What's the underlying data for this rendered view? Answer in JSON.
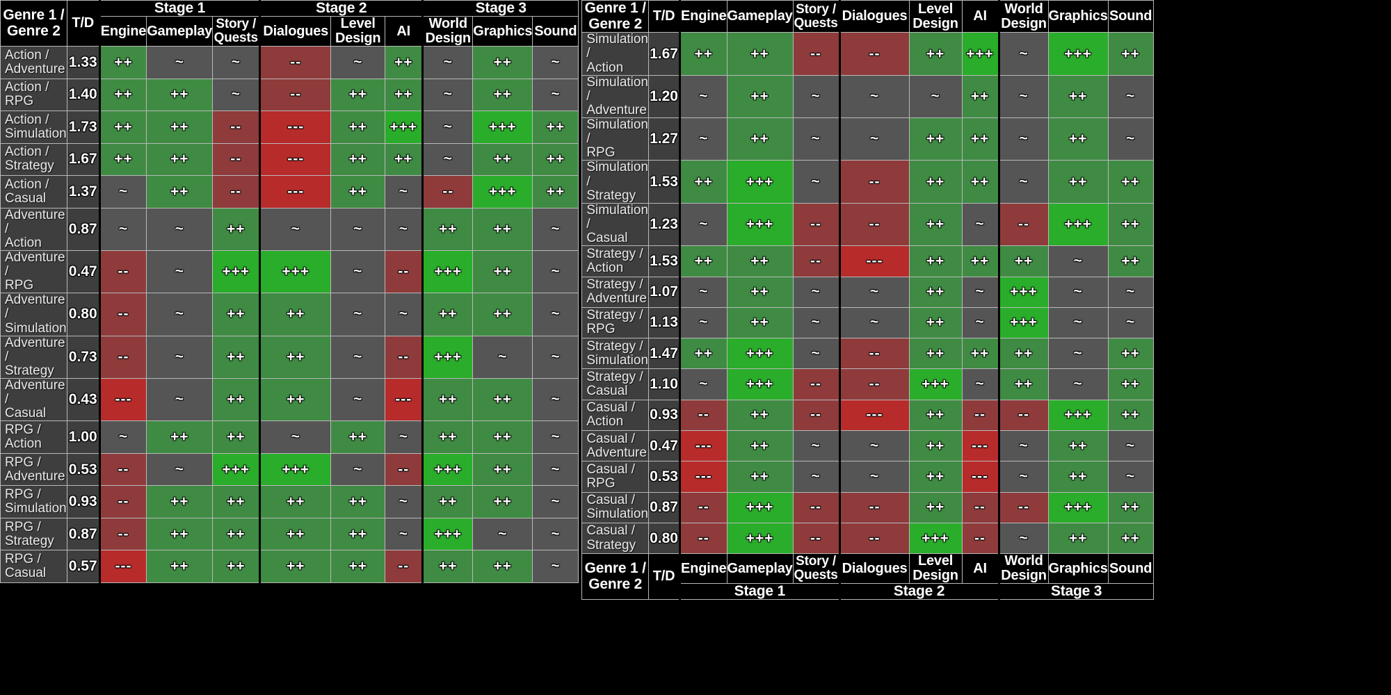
{
  "headers": {
    "genre_label": "Genre 1 /\nGenre 2",
    "genre_line1": "Genre 1 /",
    "genre_line2": "Genre 2",
    "td_label": "T/D",
    "stage1": "Stage 1",
    "stage2": "Stage 2",
    "stage3": "Stage 3",
    "columns": [
      {
        "key": "engine",
        "label": "Engine",
        "line1": "Engine",
        "line2": "",
        "stage": "Stage 1"
      },
      {
        "key": "gameplay",
        "label": "Gameplay",
        "line1": "Gameplay",
        "line2": "",
        "stage": "Stage 1"
      },
      {
        "key": "story_quests",
        "label": "Story / Quests",
        "line1": "Story /",
        "line2": "Quests",
        "stage": "Stage 1"
      },
      {
        "key": "dialogues",
        "label": "Dialogues",
        "line1": "Dialogues",
        "line2": "",
        "stage": "Stage 2"
      },
      {
        "key": "level_design",
        "label": "Level Design",
        "line1": "Level",
        "line2": "Design",
        "stage": "Stage 2"
      },
      {
        "key": "ai",
        "label": "AI",
        "line1": "AI",
        "line2": "",
        "stage": "Stage 2"
      },
      {
        "key": "world_design",
        "label": "World Design",
        "line1": "World",
        "line2": "Design",
        "stage": "Stage 3"
      },
      {
        "key": "graphics",
        "label": "Graphics",
        "line1": "Graphics",
        "line2": "",
        "stage": "Stage 3"
      },
      {
        "key": "sound",
        "label": "Sound",
        "line1": "Sound",
        "line2": "",
        "stage": "Stage 3"
      }
    ]
  },
  "rating_legend": {
    "very_positive": "+++",
    "positive": "++",
    "neutral": "~",
    "negative": "--",
    "very_negative": "---"
  },
  "colors": {
    "very_positive": "#2aad2a",
    "positive": "#3f8b43",
    "neutral": "#555555",
    "negative": "#8f3b3b",
    "very_negative": "#b82b2b",
    "header_bg": "#000000",
    "label_bg": "#3e3e3e",
    "grid_line": "#b9b9b9"
  },
  "left_table": {
    "rows": [
      {
        "genre1": "Action",
        "genre2": "Adventure",
        "label_l1": "Action /",
        "label_l2": "Adventure",
        "td": "1.33",
        "ratings": [
          "++",
          "~",
          "~",
          "--",
          "~",
          "++",
          "~",
          "++",
          "~"
        ]
      },
      {
        "genre1": "Action",
        "genre2": "RPG",
        "label_l1": "Action /",
        "label_l2": "RPG",
        "td": "1.40",
        "ratings": [
          "++",
          "++",
          "~",
          "--",
          "++",
          "++",
          "~",
          "++",
          "~"
        ]
      },
      {
        "genre1": "Action",
        "genre2": "Simulation",
        "label_l1": "Action /",
        "label_l2": "Simulation",
        "td": "1.73",
        "ratings": [
          "++",
          "++",
          "--",
          "---",
          "++",
          "+++",
          "~",
          "+++",
          "++"
        ]
      },
      {
        "genre1": "Action",
        "genre2": "Strategy",
        "label_l1": "Action /",
        "label_l2": "Strategy",
        "td": "1.67",
        "ratings": [
          "++",
          "++",
          "--",
          "---",
          "++",
          "++",
          "~",
          "++",
          "++"
        ]
      },
      {
        "genre1": "Action",
        "genre2": "Casual",
        "label_l1": "Action /",
        "label_l2": "Casual",
        "td": "1.37",
        "ratings": [
          "~",
          "++",
          "--",
          "---",
          "++",
          "~",
          "--",
          "+++",
          "++"
        ]
      },
      {
        "genre1": "Adventure",
        "genre2": "Action",
        "label_l1": "Adventure /",
        "label_l2": "Action",
        "td": "0.87",
        "ratings": [
          "~",
          "~",
          "++",
          "~",
          "~",
          "~",
          "++",
          "++",
          "~"
        ]
      },
      {
        "genre1": "Adventure",
        "genre2": "RPG",
        "label_l1": "Adventure /",
        "label_l2": "RPG",
        "td": "0.47",
        "ratings": [
          "--",
          "~",
          "+++",
          "+++",
          "~",
          "--",
          "+++",
          "++",
          "~"
        ]
      },
      {
        "genre1": "Adventure",
        "genre2": "Simulation",
        "label_l1": "Adventure /",
        "label_l2": "Simulation",
        "td": "0.80",
        "ratings": [
          "--",
          "~",
          "++",
          "++",
          "~",
          "~",
          "++",
          "++",
          "~"
        ]
      },
      {
        "genre1": "Adventure",
        "genre2": "Strategy",
        "label_l1": "Adventure /",
        "label_l2": "Strategy",
        "td": "0.73",
        "ratings": [
          "--",
          "~",
          "++",
          "++",
          "~",
          "--",
          "+++",
          "~",
          "~"
        ]
      },
      {
        "genre1": "Adventure",
        "genre2": "Casual",
        "label_l1": "Adventure /",
        "label_l2": "Casual",
        "td": "0.43",
        "ratings": [
          "---",
          "~",
          "++",
          "++",
          "~",
          "---",
          "++",
          "++",
          "~"
        ]
      },
      {
        "genre1": "RPG",
        "genre2": "Action",
        "label_l1": "RPG /",
        "label_l2": "Action",
        "td": "1.00",
        "ratings": [
          "~",
          "++",
          "++",
          "~",
          "++",
          "~",
          "++",
          "++",
          "~"
        ]
      },
      {
        "genre1": "RPG",
        "genre2": "Adventure",
        "label_l1": "RPG /",
        "label_l2": "Adventure",
        "td": "0.53",
        "ratings": [
          "--",
          "~",
          "+++",
          "+++",
          "~",
          "--",
          "+++",
          "++",
          "~"
        ]
      },
      {
        "genre1": "RPG",
        "genre2": "Simulation",
        "label_l1": "RPG /",
        "label_l2": "Simulation",
        "td": "0.93",
        "ratings": [
          "--",
          "++",
          "++",
          "++",
          "++",
          "~",
          "++",
          "++",
          "~"
        ]
      },
      {
        "genre1": "RPG",
        "genre2": "Strategy",
        "label_l1": "RPG /",
        "label_l2": "Strategy",
        "td": "0.87",
        "ratings": [
          "--",
          "++",
          "++",
          "++",
          "++",
          "~",
          "+++",
          "~",
          "~"
        ]
      },
      {
        "genre1": "RPG",
        "genre2": "Casual",
        "label_l1": "RPG /",
        "label_l2": "Casual",
        "td": "0.57",
        "ratings": [
          "---",
          "++",
          "++",
          "++",
          "++",
          "--",
          "++",
          "++",
          "~"
        ]
      }
    ]
  },
  "right_table": {
    "rows": [
      {
        "genre1": "Simulation",
        "genre2": "Action",
        "label_l1": "Simulation /",
        "label_l2": "Action",
        "td": "1.67",
        "ratings": [
          "++",
          "++",
          "--",
          "--",
          "++",
          "+++",
          "~",
          "+++",
          "++"
        ]
      },
      {
        "genre1": "Simulation",
        "genre2": "Adventure",
        "label_l1": "Simulation /",
        "label_l2": "Adventure",
        "td": "1.20",
        "ratings": [
          "~",
          "++",
          "~",
          "~",
          "~",
          "++",
          "~",
          "++",
          "~"
        ]
      },
      {
        "genre1": "Simulation",
        "genre2": "RPG",
        "label_l1": "Simulation /",
        "label_l2": "RPG",
        "td": "1.27",
        "ratings": [
          "~",
          "++",
          "~",
          "~",
          "++",
          "++",
          "~",
          "++",
          "~"
        ]
      },
      {
        "genre1": "Simulation",
        "genre2": "Strategy",
        "label_l1": "Simulation /",
        "label_l2": "Strategy",
        "td": "1.53",
        "ratings": [
          "++",
          "+++",
          "~",
          "--",
          "++",
          "++",
          "~",
          "++",
          "++"
        ]
      },
      {
        "genre1": "Simulation",
        "genre2": "Casual",
        "label_l1": "Simulation /",
        "label_l2": "Casual",
        "td": "1.23",
        "ratings": [
          "~",
          "+++",
          "--",
          "--",
          "++",
          "~",
          "--",
          "+++",
          "++"
        ]
      },
      {
        "genre1": "Strategy",
        "genre2": "Action",
        "label_l1": "Strategy /",
        "label_l2": "Action",
        "td": "1.53",
        "ratings": [
          "++",
          "++",
          "--",
          "---",
          "++",
          "++",
          "++",
          "~",
          "++"
        ]
      },
      {
        "genre1": "Strategy",
        "genre2": "Adventure",
        "label_l1": "Strategy /",
        "label_l2": "Adventure",
        "td": "1.07",
        "ratings": [
          "~",
          "++",
          "~",
          "~",
          "++",
          "~",
          "+++",
          "~",
          "~"
        ]
      },
      {
        "genre1": "Strategy",
        "genre2": "RPG",
        "label_l1": "Strategy /",
        "label_l2": "RPG",
        "td": "1.13",
        "ratings": [
          "~",
          "++",
          "~",
          "~",
          "++",
          "~",
          "+++",
          "~",
          "~"
        ]
      },
      {
        "genre1": "Strategy",
        "genre2": "Simulation",
        "label_l1": "Strategy /",
        "label_l2": "Simulation",
        "td": "1.47",
        "ratings": [
          "++",
          "+++",
          "~",
          "--",
          "++",
          "++",
          "++",
          "~",
          "++"
        ]
      },
      {
        "genre1": "Strategy",
        "genre2": "Casual",
        "label_l1": "Strategy /",
        "label_l2": "Casual",
        "td": "1.10",
        "ratings": [
          "~",
          "+++",
          "--",
          "--",
          "+++",
          "~",
          "++",
          "~",
          "++"
        ]
      },
      {
        "genre1": "Casual",
        "genre2": "Action",
        "label_l1": "Casual /",
        "label_l2": "Action",
        "td": "0.93",
        "ratings": [
          "--",
          "++",
          "--",
          "---",
          "++",
          "--",
          "--",
          "+++",
          "++"
        ]
      },
      {
        "genre1": "Casual",
        "genre2": "Adventure",
        "label_l1": "Casual /",
        "label_l2": "Adventure",
        "td": "0.47",
        "ratings": [
          "---",
          "++",
          "~",
          "~",
          "++",
          "---",
          "~",
          "++",
          "~"
        ]
      },
      {
        "genre1": "Casual",
        "genre2": "RPG",
        "label_l1": "Casual /",
        "label_l2": "RPG",
        "td": "0.53",
        "ratings": [
          "---",
          "++",
          "~",
          "~",
          "++",
          "---",
          "~",
          "++",
          "~"
        ]
      },
      {
        "genre1": "Casual",
        "genre2": "Simulation",
        "label_l1": "Casual /",
        "label_l2": "Simulation",
        "td": "0.87",
        "ratings": [
          "--",
          "+++",
          "--",
          "--",
          "++",
          "--",
          "--",
          "+++",
          "++"
        ]
      },
      {
        "genre1": "Casual",
        "genre2": "Strategy",
        "label_l1": "Casual /",
        "label_l2": "Strategy",
        "td": "0.80",
        "ratings": [
          "--",
          "+++",
          "--",
          "--",
          "+++",
          "--",
          "~",
          "++",
          "++"
        ]
      }
    ]
  }
}
